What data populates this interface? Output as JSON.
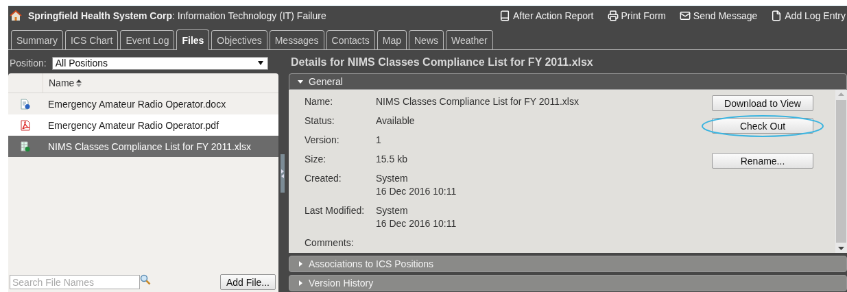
{
  "header": {
    "title": "**Springfield Health System Corp**: Information Technology (IT) Failure",
    "actions": [
      {
        "kind": "book",
        "label": "After Action Report"
      },
      {
        "kind": "printer",
        "label": "Print Form"
      },
      {
        "kind": "mail",
        "label": "Send Message"
      },
      {
        "kind": "file",
        "label": "Add Log Entry"
      }
    ]
  },
  "tabs": [
    {
      "label": "Summary",
      "selected": false
    },
    {
      "label": "ICS Chart",
      "selected": false
    },
    {
      "label": "Event Log",
      "selected": false
    },
    {
      "label": "Files",
      "selected": true
    },
    {
      "label": "Objectives",
      "selected": false
    },
    {
      "label": "Messages",
      "selected": false
    },
    {
      "label": "Contacts",
      "selected": false
    },
    {
      "label": "Map",
      "selected": false
    },
    {
      "label": "News",
      "selected": false
    },
    {
      "label": "Weather",
      "selected": false
    }
  ],
  "files_panel": {
    "position_label": "Position:",
    "position_value": "All Positions",
    "column": "Name",
    "rows": [
      {
        "kind": "word",
        "name": "Emergency Amateur Radio Operator.docx",
        "selected": false
      },
      {
        "kind": "pdf",
        "name": "Emergency Amateur Radio Operator.pdf",
        "selected": false
      },
      {
        "kind": "spreadsheet",
        "name": "NIMS Classes Compliance List for FY 2011.xlsx",
        "selected": true
      }
    ],
    "search_placeholder": "Search File Names",
    "add_button": "Add File..."
  },
  "details": {
    "title": "Details for NIMS Classes Compliance List for FY 2011.xlsx",
    "sections": [
      {
        "title": "General",
        "expanded": true
      },
      {
        "title": "Associations to ICS Positions",
        "expanded": false
      },
      {
        "title": "Version History",
        "expanded": false
      }
    ],
    "fields": [
      {
        "label": "Name:",
        "lines": [
          "NIMS Classes Compliance List for FY 2011.xlsx"
        ]
      },
      {
        "label": "Status:",
        "lines": [
          "Available"
        ]
      },
      {
        "label": "Version:",
        "lines": [
          "1"
        ]
      },
      {
        "label": "Size:",
        "lines": [
          "15.5 kb"
        ]
      },
      {
        "label": "Created:",
        "lines": [
          "System",
          "16 Dec 2016 10:11"
        ]
      },
      {
        "label": "Last Modified:",
        "lines": [
          "System",
          "16 Dec 2016 10:11"
        ]
      },
      {
        "label": "Comments:"
      }
    ],
    "buttons": [
      {
        "label": "Download to View",
        "circled": false
      },
      {
        "label": "Check Out",
        "circled": true
      },
      {
        "label": "Rename...",
        "circled": false
      }
    ]
  }
}
